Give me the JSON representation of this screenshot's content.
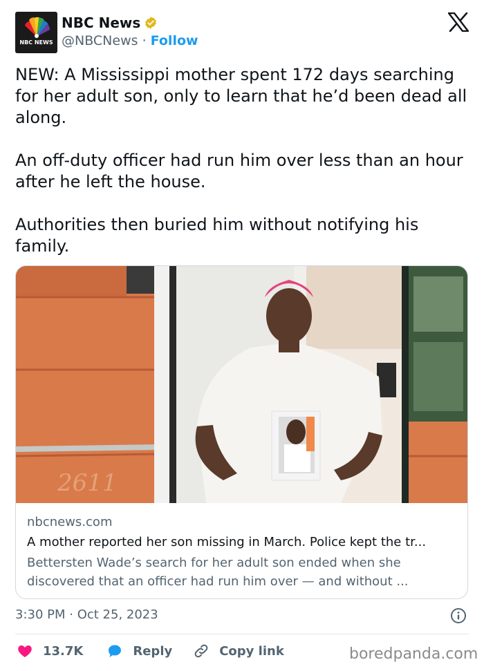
{
  "author": {
    "display_name": "NBC News",
    "handle": "@NBCNews",
    "separator": "·",
    "follow_label": "Follow",
    "avatar_wordmark": "NBC NEWS",
    "verified_icon": "verified-badge-gold"
  },
  "tweet": {
    "text": "NEW: A Mississippi mother spent 172 days searching for her adult son, only to learn that he’d been dead all along.\n\nAn off-duty officer had run him over less than an hour after he left the house.\n\nAuthorities then buried him without notifying his family.",
    "timestamp": "3:30 PM · Oct 25, 2023"
  },
  "card": {
    "domain": "nbcnews.com",
    "title": "A mother reported her son missing in March. Police kept the tr...",
    "description": "Bettersten Wade’s search for her adult son ended when she discovered that an officer had run him over — and without ...",
    "image_house_number": "2611"
  },
  "actions": {
    "like_count": "13.7K",
    "reply_label": "Reply",
    "copy_link_label": "Copy link"
  },
  "watermark": "boredpanda.com",
  "colors": {
    "link_blue": "#1d9bf0",
    "like_red": "#f91880",
    "secondary_text": "#536471",
    "verified_gold": "#e2b719"
  }
}
